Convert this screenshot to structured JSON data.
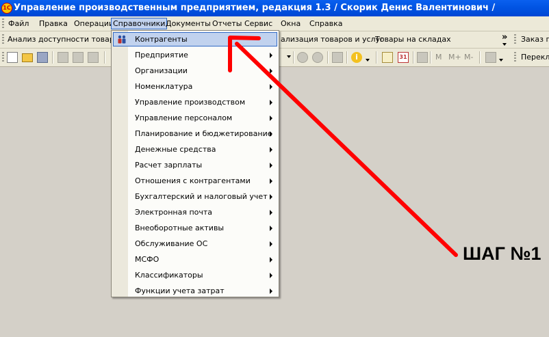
{
  "window": {
    "title": "Управление производственным предприятием, редакция 1.3 / Скорик Денис Валентинович /"
  },
  "menubar": {
    "items": [
      "Файл",
      "Правка",
      "Операции",
      "Справочники",
      "Документы",
      "Отчеты",
      "Сервис",
      "Окна",
      "Справка"
    ],
    "active": "Справочники"
  },
  "panel": {
    "left_text": "Анализ доступности товаров н",
    "hidden_text": "ализация товаров и услуг",
    "stock_text": "Товары на складах",
    "overflow": "»",
    "order_text": "Заказ по"
  },
  "toolbar": {
    "memory_buttons": [
      "M",
      "M+",
      "M-"
    ],
    "right_text": "Перекл"
  },
  "menu": {
    "items": [
      {
        "label": "Контрагенты",
        "icon": "people-icon",
        "submenu": false,
        "highlighted": true
      },
      {
        "label": "Предприятие",
        "submenu": true
      },
      {
        "label": "Организации",
        "submenu": true
      },
      {
        "label": "Номенклатура",
        "submenu": true
      },
      {
        "label": "Управление производством",
        "submenu": true
      },
      {
        "label": "Управление персоналом",
        "submenu": true
      },
      {
        "label": "Планирование и бюджетирование",
        "submenu": true
      },
      {
        "label": "Денежные средства",
        "submenu": true
      },
      {
        "label": "Расчет зарплаты",
        "submenu": true
      },
      {
        "label": "Отношения с контрагентами",
        "submenu": true
      },
      {
        "label": "Бухгалтерский и налоговый учет",
        "submenu": true
      },
      {
        "label": "Электронная почта",
        "submenu": true
      },
      {
        "label": "Внеоборотные активы",
        "submenu": true
      },
      {
        "label": "Обслуживание ОС",
        "submenu": true
      },
      {
        "label": "МСФО",
        "submenu": true
      },
      {
        "label": "Классификаторы",
        "submenu": true
      },
      {
        "label": "Функции учета затрат",
        "submenu": true
      }
    ]
  },
  "annotation": {
    "step_label": "ШАГ №1",
    "arrow_color": "#ff0000"
  },
  "colors": {
    "title_bar": "#0054e3",
    "menu_highlight": "#c1d2ee",
    "highlight_border": "#316ac5",
    "desktop": "#d4d0c8"
  }
}
